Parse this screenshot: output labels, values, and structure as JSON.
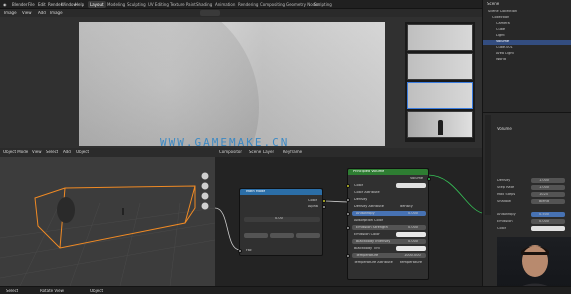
{
  "menubar": {
    "menus": [
      "Blender",
      "File",
      "Edit",
      "Render",
      "Window",
      "Help"
    ],
    "workspaces": [
      "Layout",
      "Modeling",
      "Sculpting",
      "UV Editing",
      "Texture Paint",
      "Shading",
      "Animation",
      "Rendering",
      "Compositing",
      "Geometry Nodes",
      "Scripting"
    ],
    "active_workspace": "Layout"
  },
  "viewer": {
    "header_items": [
      "Image",
      "View",
      "Add",
      "Image"
    ]
  },
  "watermark": "WWW.GAMEMAKE.CN",
  "viewport3d": {
    "header": [
      "Object Mode",
      "View",
      "Select",
      "Add",
      "Object"
    ]
  },
  "nodeeditor": {
    "header": [
      "Compositor",
      "Scene",
      "Layer",
      "Keyframe"
    ],
    "node_left": {
      "title": "Math Mode",
      "rows": [
        "Color",
        "Alpha",
        "0.00",
        "Fac"
      ]
    },
    "node_right": {
      "title": "Principled Volume",
      "output": "Volume",
      "rows": [
        {
          "label": "Color",
          "value": ""
        },
        {
          "label": "Color Attribute",
          "value": ""
        },
        {
          "label": "Density",
          "value": ""
        },
        {
          "label": "Density Attribute",
          "value": "density"
        },
        {
          "label": "Anisotropy",
          "value": "0.000"
        },
        {
          "label": "Absorption Color",
          "value": ""
        },
        {
          "label": "Emission Strength",
          "value": "0.000"
        },
        {
          "label": "Emission Color",
          "value": ""
        },
        {
          "label": "Blackbody Intensity",
          "value": "0.000"
        },
        {
          "label": "Blackbody Tint",
          "value": ""
        },
        {
          "label": "Temperature",
          "value": "1000.000"
        },
        {
          "label": "Temperature Attribute",
          "value": "temperature"
        }
      ]
    }
  },
  "outliner": {
    "title": "Scene",
    "rows": [
      "Scene Collection",
      "Collection",
      "Camera",
      "Cube",
      "Light",
      "Volume",
      "Cube.001",
      "Area Light",
      "World"
    ],
    "selected_index": 5
  },
  "properties": {
    "section": "Volume",
    "rows": [
      {
        "label": "Density",
        "value": "1.000"
      },
      {
        "label": "Step Rate",
        "value": "1.000"
      },
      {
        "label": "Max Steps",
        "value": "1024"
      },
      {
        "label": "Shadow",
        "value": "Blend"
      },
      {
        "label": "Anisotropy",
        "value": "0.500"
      },
      {
        "label": "Emission",
        "value": "0.000"
      },
      {
        "label": "Color",
        "value": ""
      }
    ]
  },
  "statusbar": {
    "left": "Select",
    "middle": "Rotate View",
    "right": "Object"
  },
  "colors": {
    "accent": "#4772b3",
    "selection": "#f08a24",
    "volume_node_header": "#2e7d32",
    "math_node_header": "#2b6ea7"
  }
}
